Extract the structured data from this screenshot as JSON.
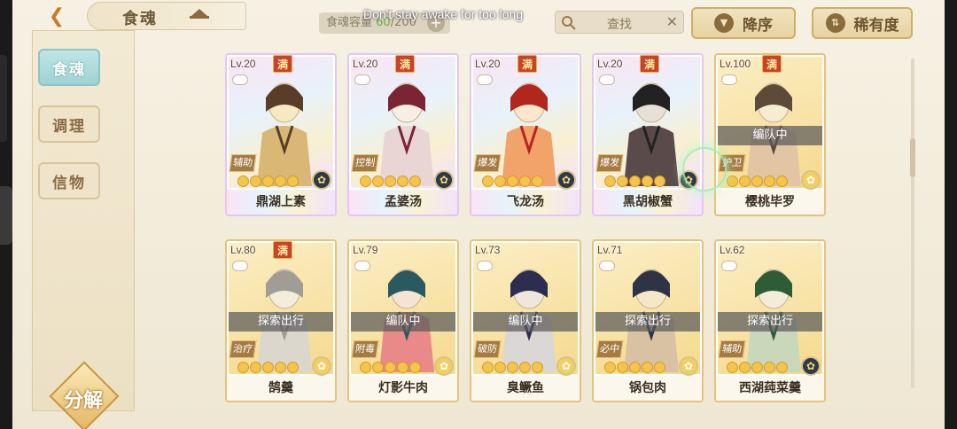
{
  "header": {
    "title": "食魂",
    "capacity_label": "食魂容量",
    "capacity_current": "60",
    "capacity_max": "/200",
    "toast": "Don't stay awake for too long",
    "search_label": "查找",
    "search_clear": "✕",
    "sort_desc_label": "降序",
    "sort_rarity_label": "稀有度"
  },
  "sidebar": {
    "items": [
      {
        "label": "食魂"
      },
      {
        "label": "调理"
      },
      {
        "label": "信物"
      }
    ],
    "decompose_label": "分解"
  },
  "cards": [
    {
      "level": "Lv.20",
      "max": "满",
      "role": "辅助",
      "status": "",
      "stars": 5,
      "name": "鼎湖上素",
      "rarity": "rainbow",
      "element_color": "dark"
    },
    {
      "level": "Lv.20",
      "max": "满",
      "role": "控制",
      "status": "",
      "stars": 5,
      "name": "孟婆汤",
      "rarity": "rainbow",
      "element_color": "dark"
    },
    {
      "level": "Lv.20",
      "max": "满",
      "role": "爆发",
      "status": "",
      "stars": 5,
      "name": "飞龙汤",
      "rarity": "rainbow",
      "element_color": "dark"
    },
    {
      "level": "Lv.20",
      "max": "满",
      "role": "爆发",
      "status": "",
      "stars": 5,
      "name": "黑胡椒蟹",
      "rarity": "rainbow",
      "element_color": "dark"
    },
    {
      "level": "Lv.100",
      "max": "满",
      "role": "护卫",
      "status": "编队中",
      "stars": 5,
      "name": "樱桃毕罗",
      "rarity": "gold",
      "element_color": "gold"
    },
    {
      "level": "Lv.80",
      "max": "满",
      "role": "治疗",
      "status": "探索出行",
      "stars": 5,
      "name": "鹄羹",
      "rarity": "gold",
      "element_color": "gold"
    },
    {
      "level": "Lv.79",
      "max": "",
      "role": "附毒",
      "status": "编队中",
      "stars": 5,
      "name": "灯影牛肉",
      "rarity": "gold",
      "element_color": "gold"
    },
    {
      "level": "Lv.73",
      "max": "",
      "role": "破防",
      "status": "编队中",
      "stars": 5,
      "name": "臭鳜鱼",
      "rarity": "gold",
      "element_color": "gold"
    },
    {
      "level": "Lv.71",
      "max": "",
      "role": "必中",
      "status": "探索出行",
      "stars": 5,
      "name": "锅包肉",
      "rarity": "gold",
      "element_color": "gold"
    },
    {
      "level": "Lv.62",
      "max": "",
      "role": "辅助",
      "status": "探索出行",
      "stars": 5,
      "name": "西湖莼菜羹",
      "rarity": "gold",
      "element_color": "dark"
    }
  ]
}
